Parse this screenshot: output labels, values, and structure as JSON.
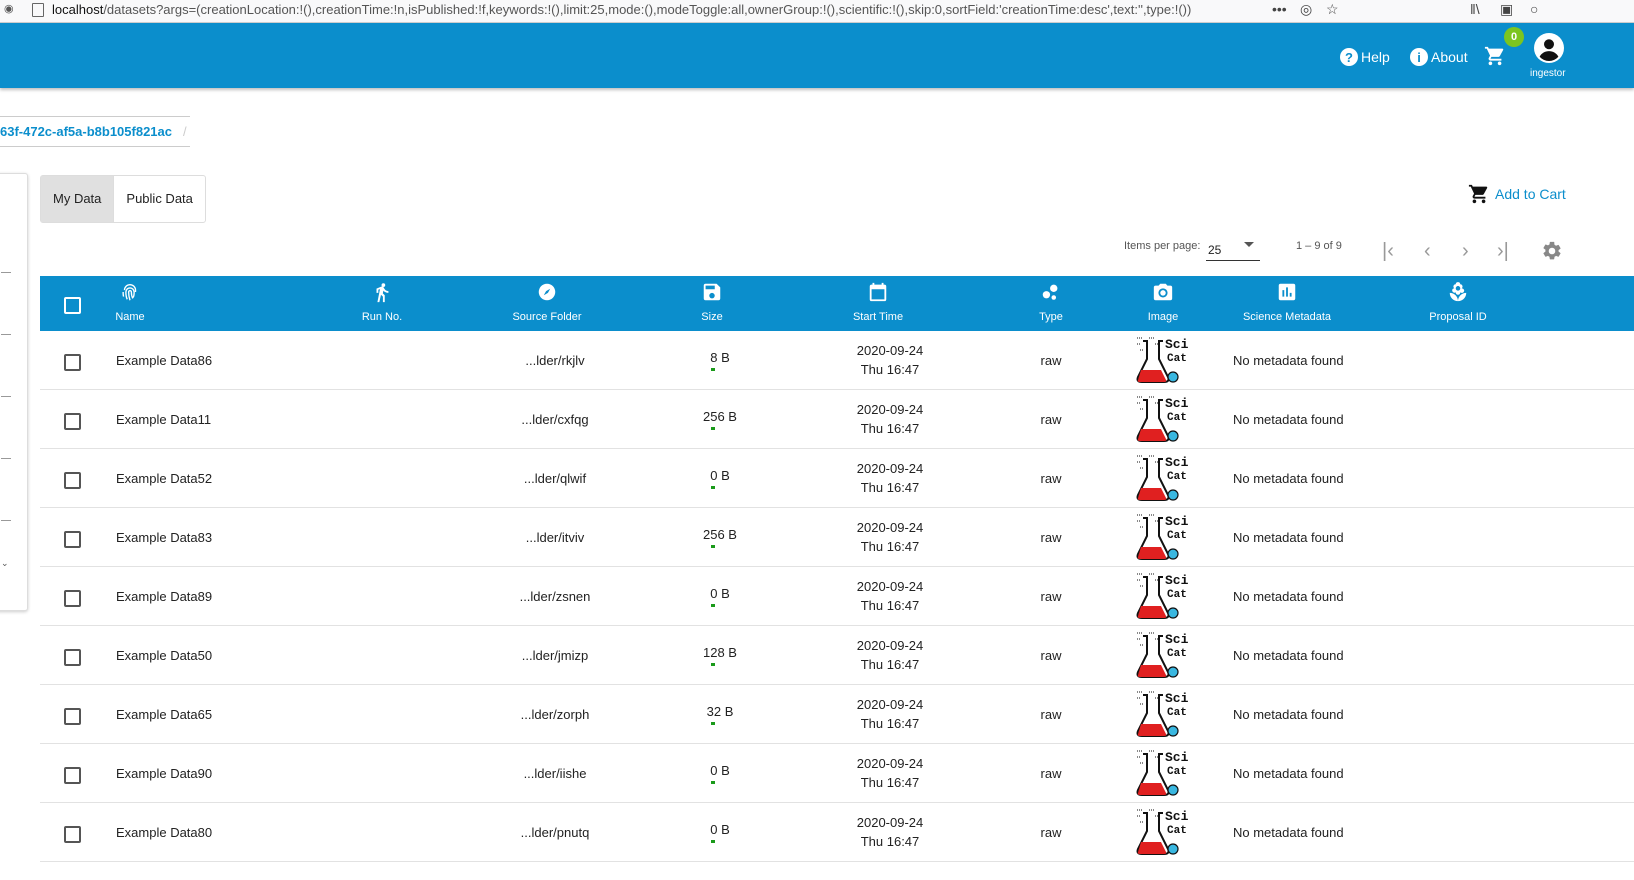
{
  "browser": {
    "url_host": "localhost",
    "url_path": "/datasets?args=(creationLocation:!(),creationTime:!n,isPublished:!f,keywords:!(),limit:25,mode:(),modeToggle:all,ownerGroup:!(),scientific:!(),skip:0,sortField:'creationTime:desc',text:'',type:!())",
    "more": "•••"
  },
  "header": {
    "help_label": "Help",
    "about_label": "About",
    "cart_count": "0",
    "username": "ingestor"
  },
  "breadcrumb": {
    "text": "63f-472c-af5a-b8b105f821ac",
    "separator": "/"
  },
  "mode_toggle": {
    "my_data": "My Data",
    "public_data": "Public Data"
  },
  "actions": {
    "add_to_cart": "Add to Cart"
  },
  "paginator": {
    "items_per_page_label": "Items per page:",
    "page_size": "25",
    "range": "1 – 9 of 9"
  },
  "table": {
    "columns": {
      "name": "Name",
      "run_no": "Run No.",
      "source_folder": "Source Folder",
      "size": "Size",
      "start_time": "Start Time",
      "type": "Type",
      "image": "Image",
      "science_metadata": "Science Metadata",
      "proposal_id": "Proposal ID"
    },
    "rows": [
      {
        "name": "Example Data86",
        "source": "...lder/rkjlv",
        "size": "8 B",
        "date": "2020-09-24",
        "time": "Thu 16:47",
        "type": "raw",
        "meta": "No metadata found"
      },
      {
        "name": "Example Data11",
        "source": "...lder/cxfqg",
        "size": "256 B",
        "date": "2020-09-24",
        "time": "Thu 16:47",
        "type": "raw",
        "meta": "No metadata found"
      },
      {
        "name": "Example Data52",
        "source": "...lder/qlwif",
        "size": "0 B",
        "date": "2020-09-24",
        "time": "Thu 16:47",
        "type": "raw",
        "meta": "No metadata found"
      },
      {
        "name": "Example Data83",
        "source": "...lder/itviv",
        "size": "256 B",
        "date": "2020-09-24",
        "time": "Thu 16:47",
        "type": "raw",
        "meta": "No metadata found"
      },
      {
        "name": "Example Data89",
        "source": "...lder/zsnen",
        "size": "0 B",
        "date": "2020-09-24",
        "time": "Thu 16:47",
        "type": "raw",
        "meta": "No metadata found"
      },
      {
        "name": "Example Data50",
        "source": "...lder/jmizp",
        "size": "128 B",
        "date": "2020-09-24",
        "time": "Thu 16:47",
        "type": "raw",
        "meta": "No metadata found"
      },
      {
        "name": "Example Data65",
        "source": "...lder/zorph",
        "size": "32 B",
        "date": "2020-09-24",
        "time": "Thu 16:47",
        "type": "raw",
        "meta": "No metadata found"
      },
      {
        "name": "Example Data90",
        "source": "...lder/iishe",
        "size": "0 B",
        "date": "2020-09-24",
        "time": "Thu 16:47",
        "type": "raw",
        "meta": "No metadata found"
      },
      {
        "name": "Example Data80",
        "source": "...lder/pnutq",
        "size": "0 B",
        "date": "2020-09-24",
        "time": "Thu 16:47",
        "type": "raw",
        "meta": "No metadata found"
      }
    ],
    "thumbnail_text_1": "Sci",
    "thumbnail_text_2": "Cat"
  },
  "colors": {
    "primary": "#0b8ecc",
    "badge": "#7cc520"
  }
}
